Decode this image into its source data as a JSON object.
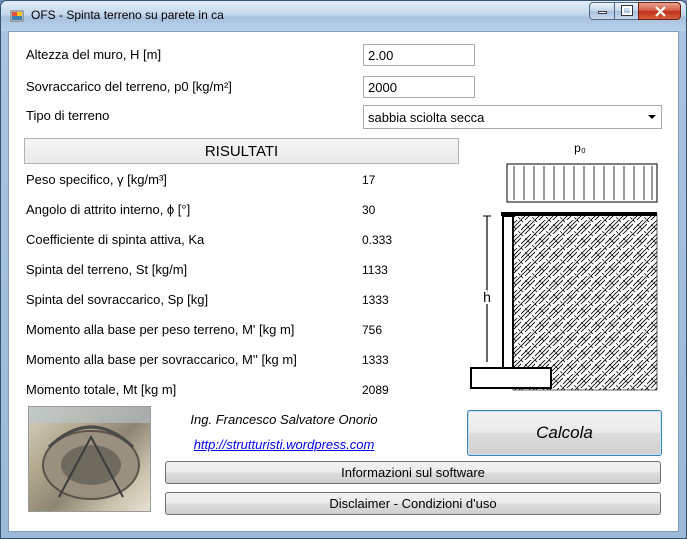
{
  "window": {
    "title": "OFS - Spinta terreno su parete in ca"
  },
  "inputs": {
    "altezza_label": "Altezza del muro, H [m]",
    "altezza_value": "2.00",
    "sovraccarico_label": "Sovraccarico del terreno, p0 [kg/m²]",
    "sovraccarico_value": "2000",
    "terreno_label": "Tipo di terreno",
    "terreno_selected": "sabbia sciolta secca"
  },
  "results": {
    "header": "RISULTATI",
    "rows": [
      {
        "label": "Peso specifico, γ [kg/m³]",
        "value": "17"
      },
      {
        "label": "Angolo di attrito interno, ϕ [°]",
        "value": "30"
      },
      {
        "label": "Coefficiente di spinta attiva, Ka",
        "value": "0.333"
      },
      {
        "label": "Spinta del terreno, St [kg/m]",
        "value": "1133"
      },
      {
        "label": "Spinta del sovraccarico, Sp [kg]",
        "value": "1333"
      },
      {
        "label": "Momento alla base per peso terreno, M' [kg m]",
        "value": "756"
      },
      {
        "label": "Momento alla base per sovraccarico, M'' [kg m]",
        "value": "1333"
      },
      {
        "label": "Momento totale, Mt [kg m]",
        "value": "2089"
      }
    ]
  },
  "diagram": {
    "load_label": "p₀",
    "height_label": "h"
  },
  "footer": {
    "author": "Ing. Francesco Salvatore Onorio",
    "link": "http://strutturisti.wordpress.com",
    "calcola_label": "Calcola",
    "info_label": "Informazioni sul software",
    "disclaimer_label": "Disclaimer - Condizioni d'uso"
  },
  "colors": {
    "link": "#0000ee",
    "close_button": "#c0311a",
    "titlebar": "#b9d1ea"
  }
}
